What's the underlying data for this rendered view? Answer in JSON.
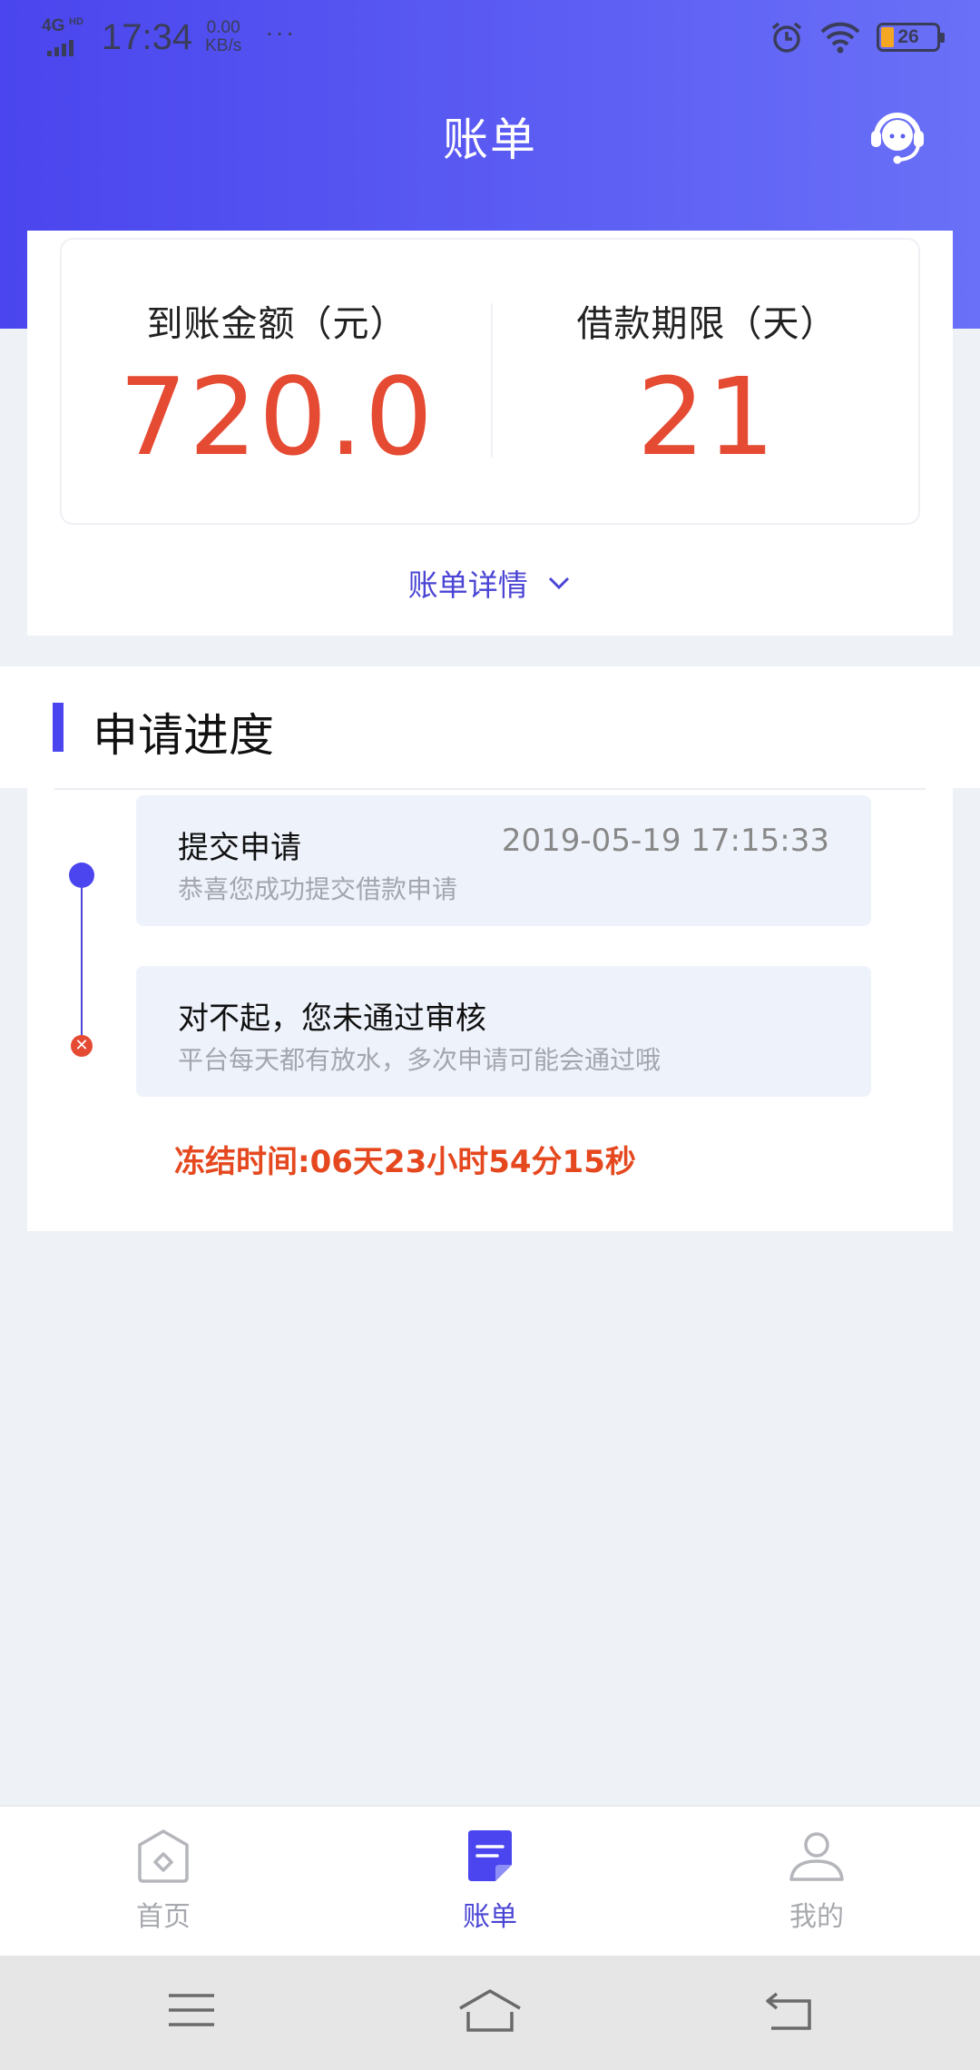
{
  "status_bar": {
    "network": "4G",
    "network_hd": "HD",
    "time": "17:34",
    "net_speed_value": "0.00",
    "net_speed_unit": "KB/s",
    "more": "···",
    "battery": "26",
    "icons": [
      "alarm-icon",
      "wifi-icon",
      "battery-icon"
    ]
  },
  "header": {
    "title": "账单",
    "service_icon": "customer-service-icon",
    "gradient": [
      "#4a45ee",
      "#6a70f7"
    ]
  },
  "summary": {
    "amount_label": "到账金额（元）",
    "amount_value": "720.0",
    "term_label": "借款期限（天）",
    "term_value": "21",
    "detail_link": "账单详情"
  },
  "progress": {
    "title": "申请进度",
    "steps": [
      {
        "title": "提交申请",
        "time": "2019-05-19 17:15:33",
        "desc": "恭喜您成功提交借款申请",
        "status": "done"
      },
      {
        "title": "对不起，您未通过审核",
        "time": "",
        "desc": "平台每天都有放水，多次申请可能会通过哦",
        "status": "rejected"
      }
    ],
    "freeze": "冻结时间:06天23小时54分15秒"
  },
  "tabs": [
    {
      "label": "首页",
      "icon": "home-icon",
      "active": false
    },
    {
      "label": "账单",
      "icon": "bill-icon",
      "active": true
    },
    {
      "label": "我的",
      "icon": "user-icon",
      "active": false
    }
  ],
  "colors": {
    "accent": "#4a45ee",
    "danger": "#e54a33",
    "background": "#eef1f5"
  }
}
